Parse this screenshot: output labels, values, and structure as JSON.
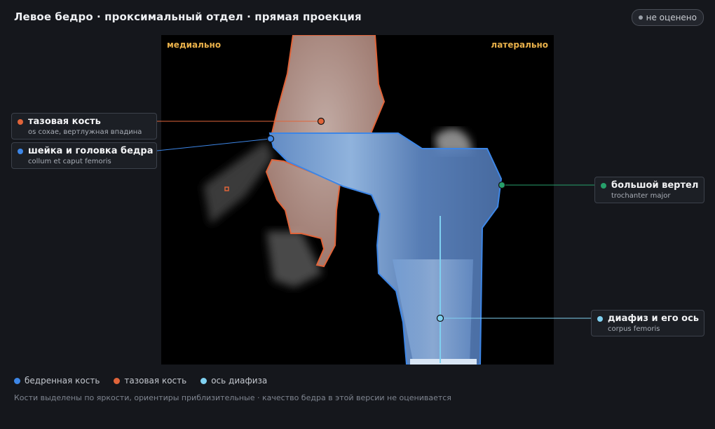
{
  "header": {
    "title": "Левое бедро · проксимальный отдел · прямая проекция",
    "status_badge": "не оценено"
  },
  "image": {
    "orientation_left": "медиально",
    "orientation_right": "латерально"
  },
  "callouts": [
    {
      "id": "pelvis",
      "name": "тазовая кость",
      "latin": "os coxae, вертлужная впадина",
      "color": "#e0643a"
    },
    {
      "id": "neck",
      "name": "шейка и головка бедра",
      "latin": "collum et caput femoris",
      "color": "#3d86e6"
    },
    {
      "id": "trochanter",
      "name": "большой вертел",
      "latin": "trochanter major",
      "color": "#27a06b"
    },
    {
      "id": "shaft",
      "name": "диафиз и его ось",
      "latin": "corpus femoris",
      "color": "#7fd0f0"
    }
  ],
  "legend": [
    {
      "label": "бедренная кость",
      "color": "#3d86e6"
    },
    {
      "label": "тазовая кость",
      "color": "#e0643a"
    },
    {
      "label": "ось диафиза",
      "color": "#7fd0f0"
    }
  ],
  "footnote": "Кости выделены по яркости, ориентиры приблизительные · качество бедра в этой версии не оценивается"
}
